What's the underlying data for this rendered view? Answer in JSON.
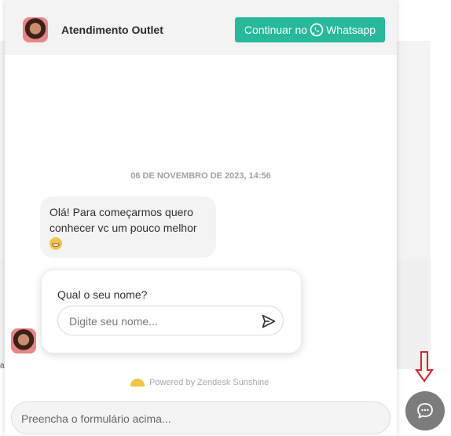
{
  "header": {
    "title": "Atendimento Outlet",
    "whatsapp_button_prefix": "Continuar no",
    "whatsapp_button_suffix": "Whatsapp"
  },
  "conversation": {
    "date_stamp": "06 DE NOVEMBRO DE 2023, 14:56",
    "message_text": "Olá! Para começarmos quero conhecer vc um pouco melhor"
  },
  "form": {
    "label": "Qual o seu nome?",
    "placeholder": "Digite seu nome..."
  },
  "footer": {
    "powered_by": "Powered by Zendesk Sunshine"
  },
  "composer": {
    "placeholder": "Preencha o formulário acima..."
  },
  "background": {
    "left_fragment_text": "a"
  },
  "icons": {
    "whatsapp": "whatsapp-icon",
    "send": "send-icon",
    "launcher": "chat-bubble-icon",
    "arrow": "arrow-down-icon",
    "emoji": "grinning-face-icon"
  },
  "colors": {
    "whatsapp_button": "#27b99a",
    "launcher": "#7c7c7c",
    "arrow": "#d9262b"
  }
}
